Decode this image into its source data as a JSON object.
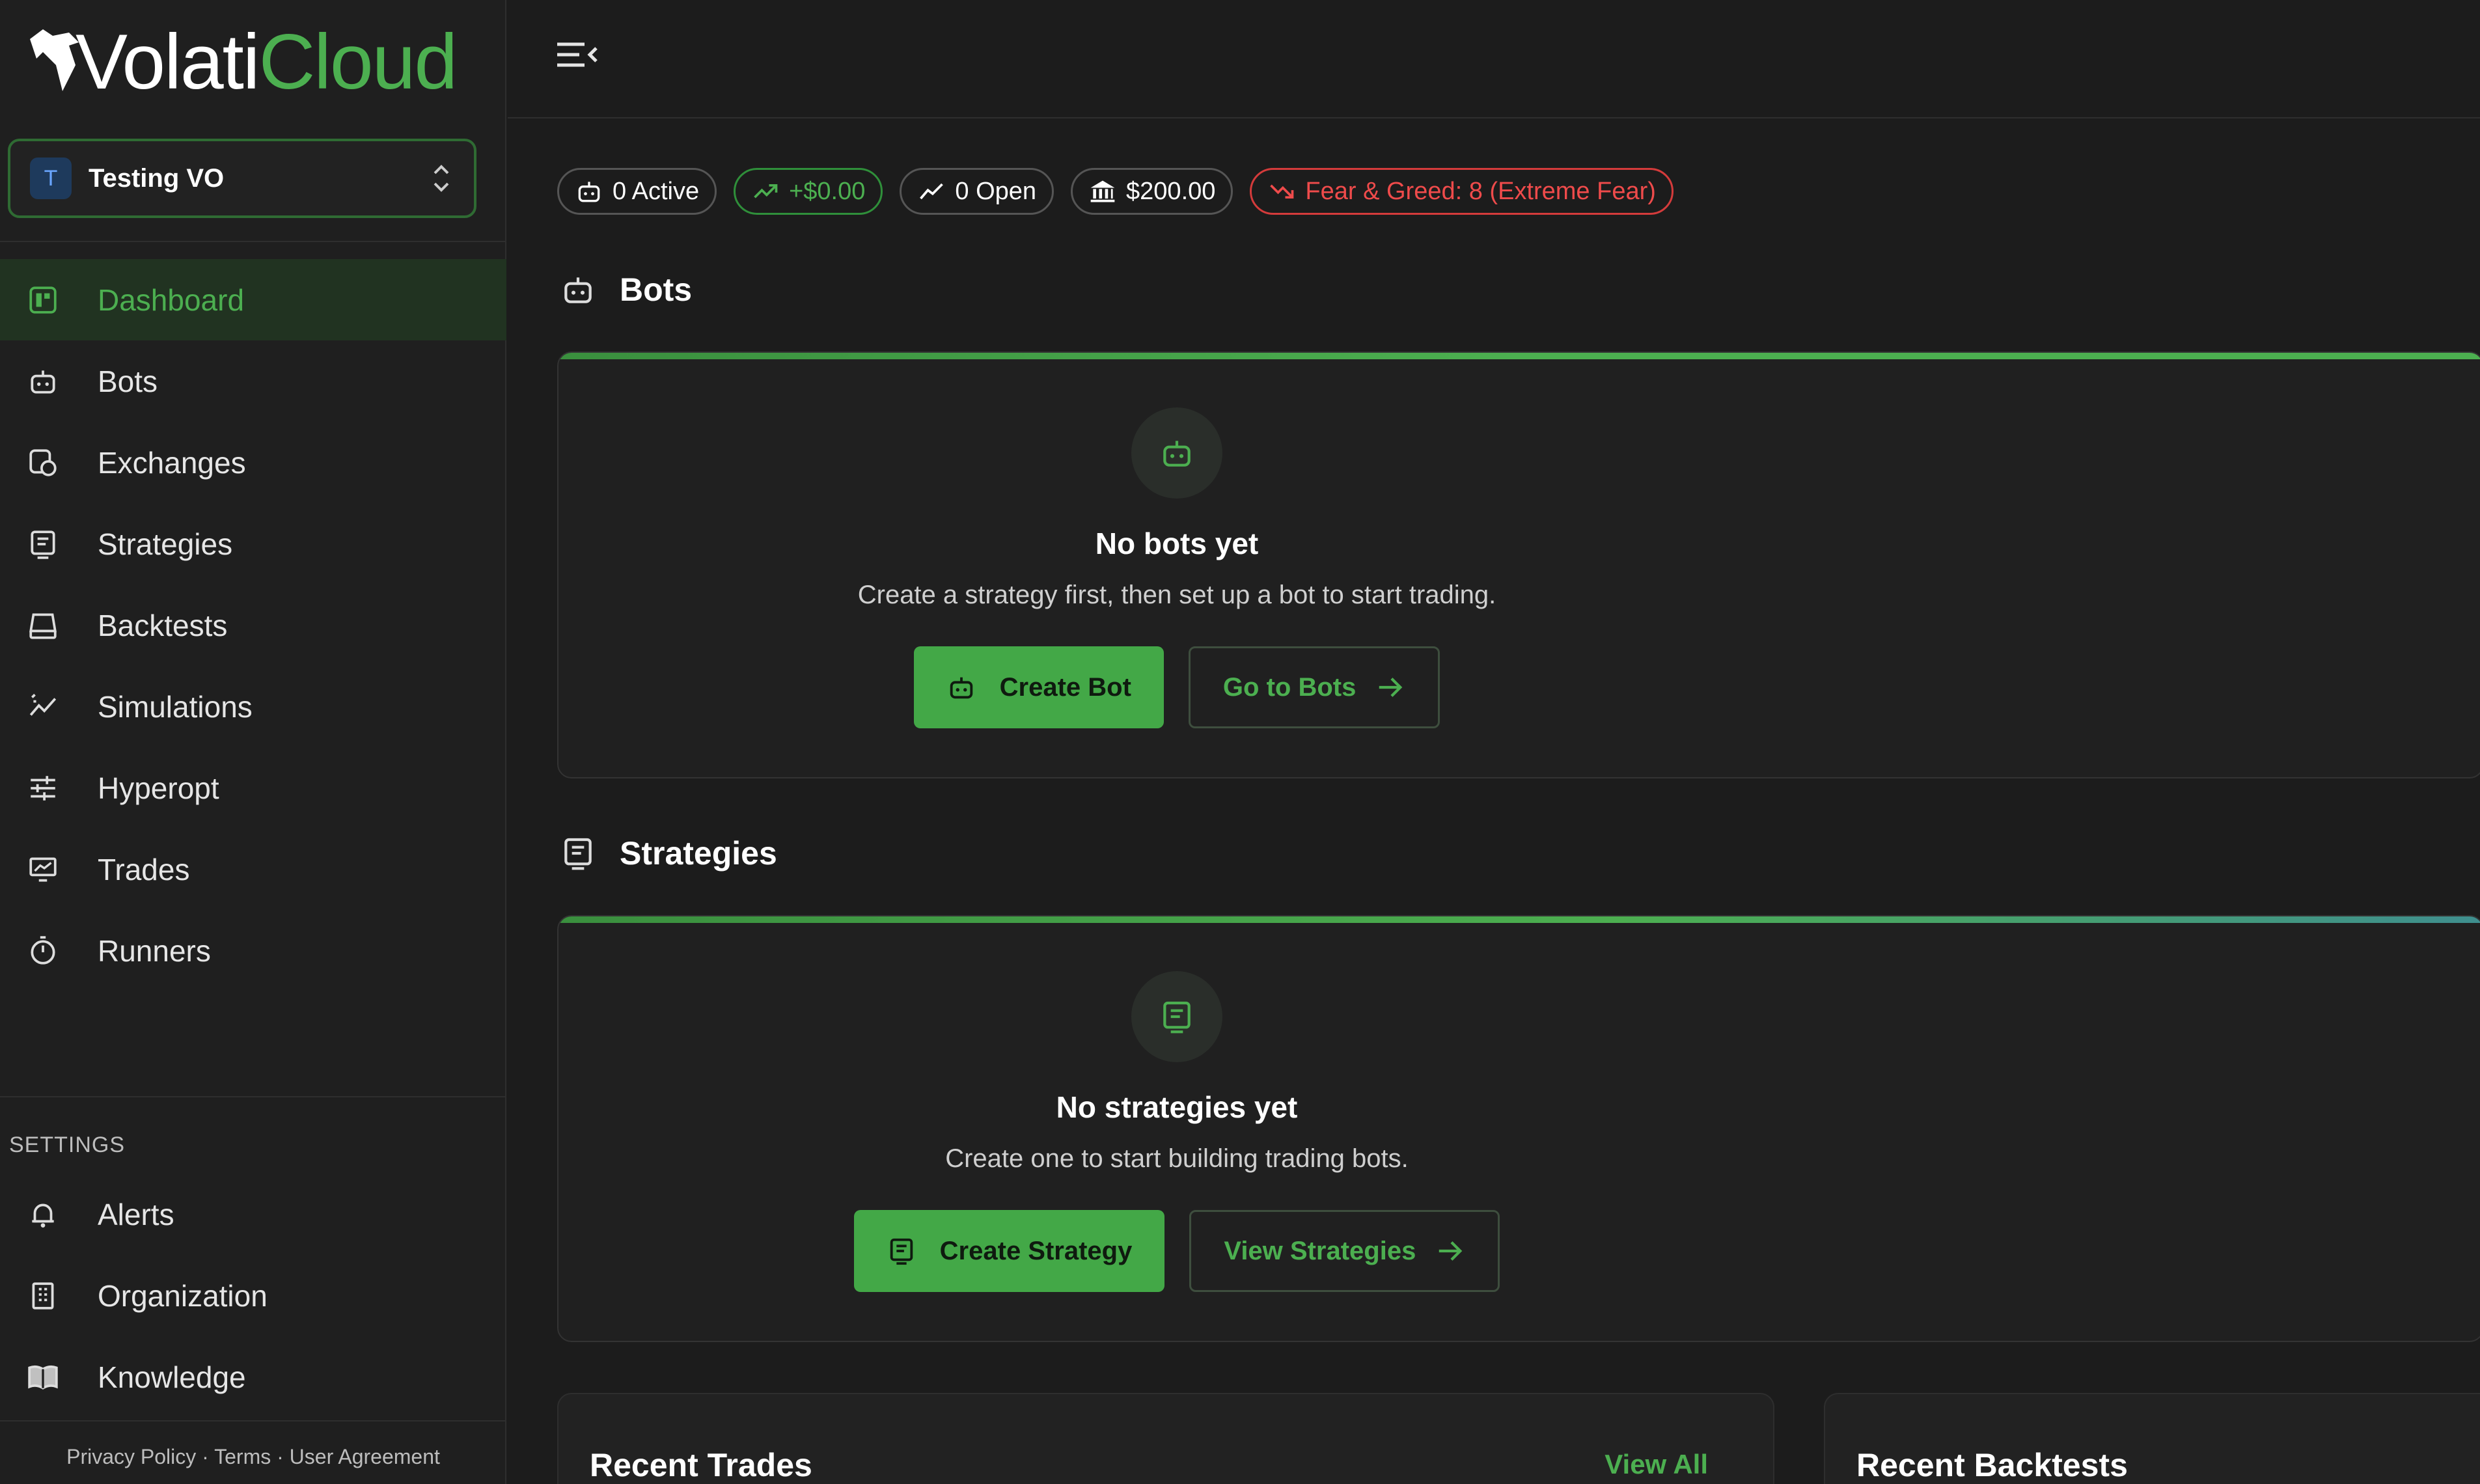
{
  "brand": {
    "part1": "Volati",
    "part2": "Cloud"
  },
  "org": {
    "avatar_letter": "T",
    "name": "Testing VO"
  },
  "nav": [
    {
      "label": "Dashboard",
      "icon": "dashboard-icon",
      "active": true
    },
    {
      "label": "Bots",
      "icon": "robot-icon"
    },
    {
      "label": "Exchanges",
      "icon": "exchange-icon"
    },
    {
      "label": "Strategies",
      "icon": "strategy-icon"
    },
    {
      "label": "Backtests",
      "icon": "backtest-icon"
    },
    {
      "label": "Simulations",
      "icon": "simulation-icon"
    },
    {
      "label": "Hyperopt",
      "icon": "sliders-icon"
    },
    {
      "label": "Trades",
      "icon": "monitor-chart-icon"
    },
    {
      "label": "Runners",
      "icon": "stopwatch-icon"
    }
  ],
  "settings": {
    "label": "SETTINGS",
    "items": [
      {
        "label": "Alerts",
        "icon": "bell-icon"
      },
      {
        "label": "Organization",
        "icon": "building-icon"
      },
      {
        "label": "Knowledge",
        "icon": "book-icon"
      }
    ]
  },
  "footer": {
    "privacy": "Privacy Policy",
    "sep": "·",
    "terms": "Terms",
    "agreement": "User Agreement"
  },
  "stats": {
    "active": "0 Active",
    "pnl": "+$0.00",
    "open": "0 Open",
    "balance": "$200.00",
    "fear_greed": "Fear & Greed: 8 (Extreme Fear)"
  },
  "bots_section": {
    "title": "Bots",
    "empty_title": "No bots yet",
    "empty_desc": "Create a strategy first, then set up a bot to start trading.",
    "primary_btn": "Create Bot",
    "secondary_btn": "Go to Bots"
  },
  "strategies_section": {
    "title": "Strategies",
    "empty_title": "No strategies yet",
    "empty_desc": "Create one to start building trading bots.",
    "primary_btn": "Create Strategy",
    "secondary_btn": "View Strategies"
  },
  "recent_trades": {
    "title": "Recent Trades",
    "link": "View All"
  },
  "recent_backtests": {
    "title": "Recent Backtests"
  },
  "colors": {
    "accent": "#4caf50",
    "danger": "#ef4b4b",
    "bg": "#1c1c1c"
  }
}
